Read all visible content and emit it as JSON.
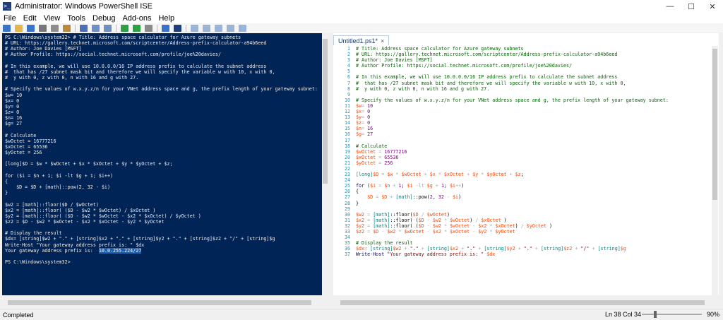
{
  "window": {
    "title": "Administrator: Windows PowerShell ISE",
    "icon_glyph": ">_",
    "buttons": {
      "minimize": "—",
      "maximize": "☐",
      "close": "✕"
    }
  },
  "menu": [
    "File",
    "Edit",
    "View",
    "Tools",
    "Debug",
    "Add-ons",
    "Help"
  ],
  "toolbar": {
    "icons": [
      {
        "name": "new-file-icon",
        "color": "#3a74c9"
      },
      {
        "name": "open-folder-icon",
        "color": "#e4b64a"
      },
      {
        "name": "save-icon",
        "color": "#3a74c9"
      },
      {
        "name": "cut-icon",
        "color": "#777777"
      },
      {
        "name": "copy-icon",
        "color": "#8d8d8d"
      },
      {
        "name": "paste-icon",
        "color": "#b98a3e"
      },
      {
        "name": "clear-console-icon",
        "color": "#4b6fb5"
      },
      {
        "name": "undo-icon",
        "color": "#6f8fc2"
      },
      {
        "name": "redo-icon",
        "color": "#6f8fc2"
      },
      {
        "name": "run-script-icon",
        "color": "#2ea043"
      },
      {
        "name": "run-selection-icon",
        "color": "#2ea043"
      },
      {
        "name": "stop-icon",
        "color": "#8a8a8a"
      },
      {
        "name": "new-remote-tab-icon",
        "color": "#3a74c9"
      },
      {
        "name": "start-powershell-icon",
        "color": "#1f3f7a"
      },
      {
        "name": "show-script-pane-top-icon",
        "color": "#9bb4d6"
      },
      {
        "name": "show-script-pane-right-icon",
        "color": "#9bb4d6"
      },
      {
        "name": "show-script-pane-max-icon",
        "color": "#9bb4d6"
      },
      {
        "name": "show-command-window-icon",
        "color": "#9bb4d6"
      },
      {
        "name": "show-command-addon-icon",
        "color": "#9bb4d6"
      }
    ]
  },
  "console": {
    "lines": [
      "PS C:\\Windows\\system32> # Title: Address space calculator for Azure gateway subnets",
      "# URL: https://gallery.technet.microsoft.com/scriptcenter/Address-prefix-calculator-a94b6eed",
      "# Author: Joe Davies [MSFT]",
      "# Author Profile: https://social.technet.microsoft.com/profile/joe%20davies/",
      "",
      "# In this example, we will use 10.0.0.0/16 IP address prefix to calculate the subnet address",
      "#  that has /27 subnet mask bit and therefore we will specify the variable w with 10, x with 0,",
      "#  y with 0, z with 0, n with 16 and g with 27.",
      "",
      "# Specify the values of w.x.y.z/n for your VNet address space and g, the prefix length of your gateway subnet:",
      "$w= 10",
      "$x= 0",
      "$y= 0",
      "$z= 0",
      "$n= 16",
      "$g= 27",
      "",
      "# Calculate",
      "$wOctet = 16777216",
      "$xOctet = 65536",
      "$yOctet = 256",
      "",
      "[long]$D = $w * $wOctet + $x * $xOctet + $y * $yOctet + $z;",
      "",
      "for ($i = $n + 1; $i -lt $g + 1; $i++)",
      "{",
      "    $D = $D + [math]::pow(2, 32 - $i)",
      "}",
      "",
      "$w2 = [math]::floor($D / $wOctet)",
      "$x2 = [math]::floor( ($D - $w2 * $wOctet) / $xOctet )",
      "$y2 = [math]::floor( ($D - $w2 * $wOctet - $x2 * $xOctet) / $yOctet )",
      "$z2 = $D - $w2 * $wOctet - $x2 * $xOctet - $y2 * $yOctet",
      "",
      "# Display the result",
      "$dx= [string]$w2 + \".\" + [string]$x2 + \".\" + [string]$y2 + \".\" + [string]$z2 + \"/\" + [string]$g",
      "Write-Host \"Your gateway address prefix is: \" $dx"
    ],
    "result_label": "Your gateway address prefix is:  ",
    "result_value": "10.0.255.224/27",
    "final_prompt": "PS C:\\Windows\\system32>"
  },
  "editor": {
    "tab_label": "Untitled1.ps1*",
    "tab_close": "×",
    "line_numbers": [
      "1",
      "2",
      "3",
      "4",
      "5",
      "6",
      "7",
      "8",
      "9",
      "10",
      "11",
      "12",
      "13",
      "14",
      "15",
      "16",
      "17",
      "18",
      "19",
      "20",
      "21",
      "22",
      "23",
      "24",
      "25",
      "26",
      "27",
      "28",
      "29",
      "30",
      "31",
      "32",
      "33",
      "34",
      "35",
      "36",
      "37"
    ]
  },
  "status": {
    "text": "Completed",
    "position": "Ln 38  Col 34",
    "zoom": "90%",
    "zoom_fraction": 0.22
  },
  "colors": {
    "console_bg": "#012456",
    "comment": "#006400",
    "variable": "#ff4500",
    "number": "#800080",
    "keyword": "#00008b",
    "type": "#008080",
    "string": "#8b0000",
    "line_number": "#2b91af"
  }
}
